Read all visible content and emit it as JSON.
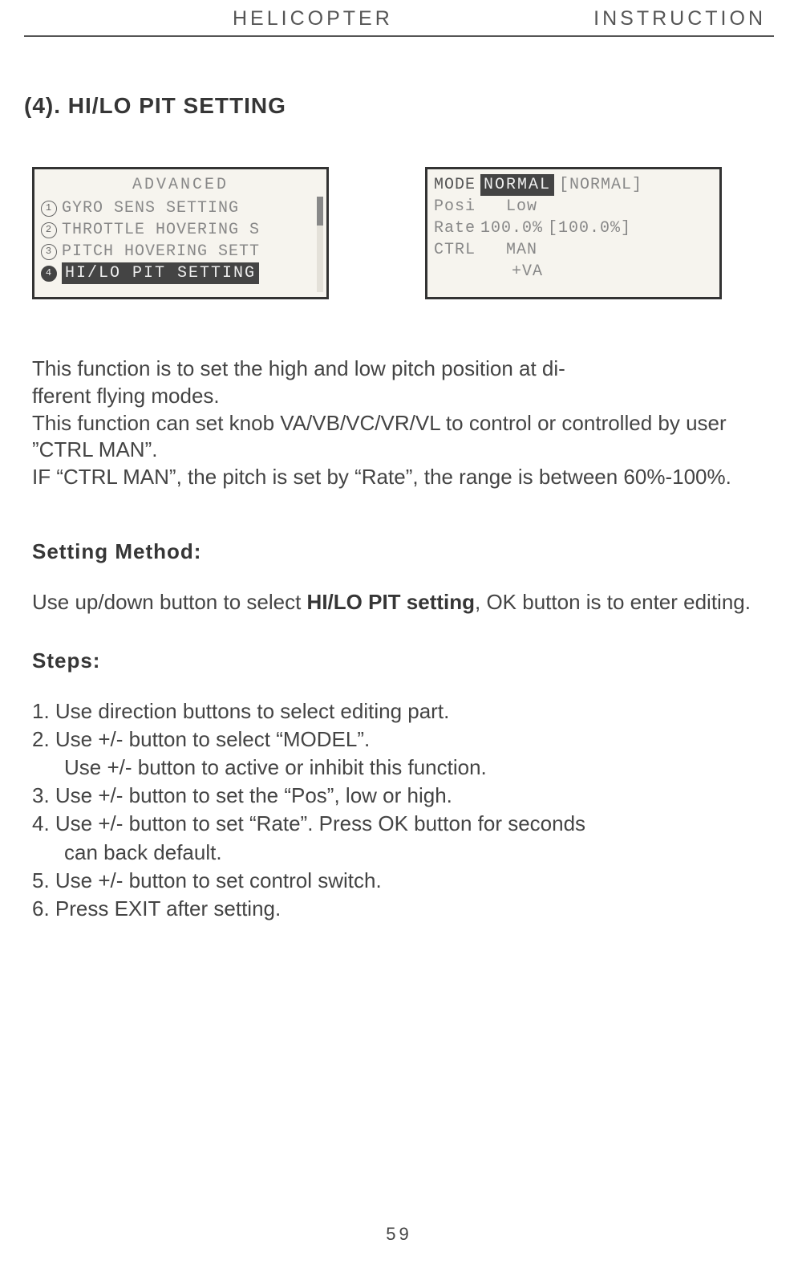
{
  "header": {
    "left": "HELICOPTER",
    "right": "INSTRUCTION"
  },
  "section_title": "(4). HI/LO PIT SETTING",
  "lcd_left": {
    "title": "ADVANCED",
    "items": [
      {
        "num": "1",
        "label": "GYRO SENS SETTING",
        "selected": false
      },
      {
        "num": "2",
        "label": "THROTTLE HOVERING S",
        "selected": false
      },
      {
        "num": "3",
        "label": "PITCH HOVERING SETT",
        "selected": false
      },
      {
        "num": "4",
        "label": "HI/LO PIT SETTING",
        "selected": true
      }
    ]
  },
  "lcd_right": {
    "lines": {
      "mode_label": "MODE",
      "mode_value_inv": "NORMAL",
      "mode_bracket": "[NORMAL]",
      "posi_label": "Posi",
      "posi_value": "Low",
      "rate_label": "Rate",
      "rate_value": "100.0%",
      "rate_bracket": "[100.0%]",
      "ctrl_label": "CTRL",
      "ctrl_value": "MAN",
      "va_label": "+VA"
    }
  },
  "body": {
    "p1": "This function is to set the high and low pitch position  at di-\nfferent flying modes.",
    "p2": "This function can set knob VA/VB/VC/VR/VL to control or controlled by user ”CTRL MAN”.",
    "p3": "IF “CTRL MAN”, the pitch is set by “Rate”, the range is between 60%-100%."
  },
  "setting_method_heading": "Setting Method:",
  "setting_method_text_before": "Use up/down button to select ",
  "setting_method_bold": "HI/LO PIT setting",
  "setting_method_text_after": ", OK button is to enter editing.",
  "steps_heading": "Steps:",
  "steps": {
    "s1": "1. Use direction buttons to select editing part.",
    "s2": "2. Use +/- button to select “MODEL”.",
    "s2b": "Use +/- button to active or inhibit this function.",
    "s3": "3. Use +/- button to set the “Pos”, low or high.",
    "s4": "4. Use +/- button to set “Rate”. Press OK button for seconds",
    "s4b": "can back default.",
    "s5": "5. Use +/- button to set control switch.",
    "s6": "6. Press EXIT after setting."
  },
  "page_number": "59"
}
